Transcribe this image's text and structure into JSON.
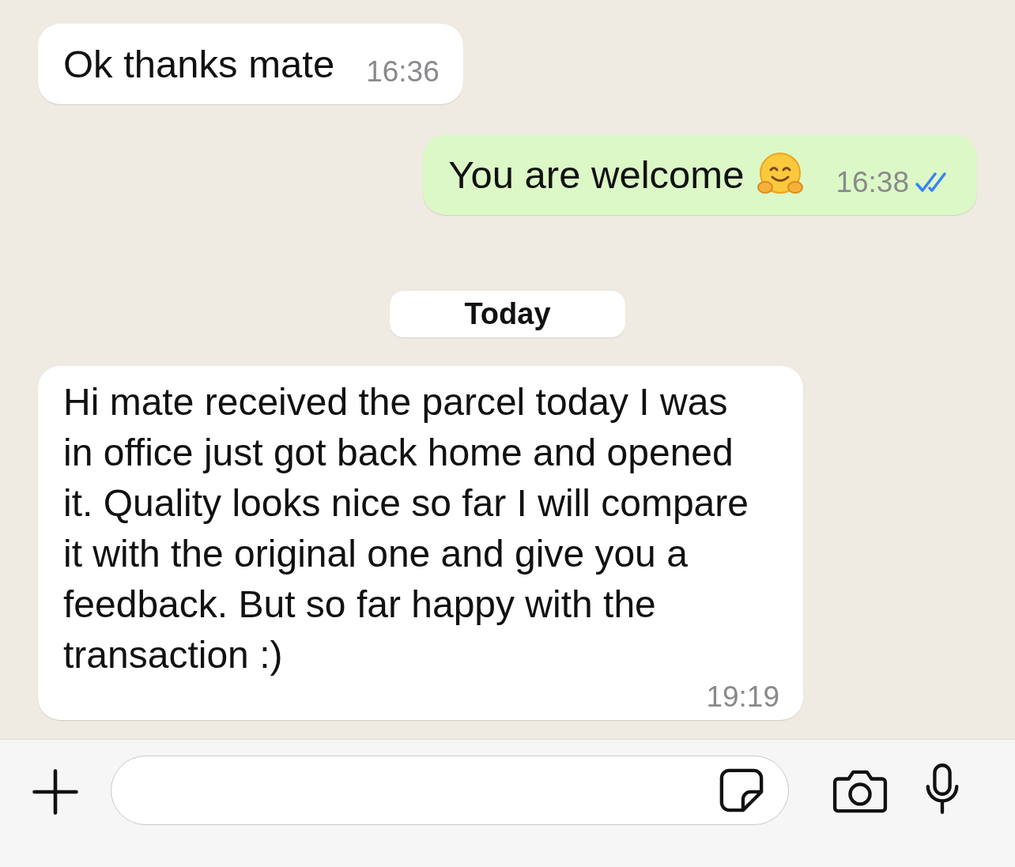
{
  "messages": [
    {
      "kind": "incoming",
      "text": "Ok thanks mate",
      "time": "16:36"
    },
    {
      "kind": "outgoing",
      "text": "You are welcome",
      "emoji": true,
      "time": "16:38",
      "read": true
    },
    {
      "kind": "date",
      "text": "Today"
    },
    {
      "kind": "incoming",
      "text": "Hi mate received the parcel today I was in office just got back home and opened it. Quality looks nice so far I will compare it with the original one and give you a feedback. But so far happy with the transaction :)",
      "time": "19:19"
    }
  ]
}
